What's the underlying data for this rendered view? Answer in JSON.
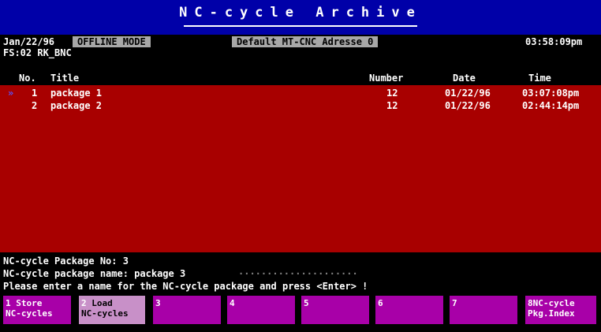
{
  "header": {
    "app_title": "NC-cycle Archive",
    "date": "Jan/22/96",
    "mode": "OFFLINE MODE",
    "address": "Default MT-CNC Adresse 0",
    "time": "03:58:09pm",
    "status_line": "FS:02 RK_BNC"
  },
  "table": {
    "columns": [
      "No.",
      "Title",
      "Number",
      "Date",
      "Time"
    ],
    "cursor_glyph": "»",
    "rows": [
      {
        "no": "1",
        "title": "package 1",
        "number": "12",
        "date": "01/22/96",
        "time": "03:07:08pm"
      },
      {
        "no": "2",
        "title": "package 2",
        "number": "12",
        "date": "01/22/96",
        "time": "02:44:14pm"
      }
    ]
  },
  "prompts": {
    "package_no": "NC-cycle Package No: 3",
    "package_name_label": "NC-cycle package name: package 3",
    "dots": "·····················",
    "instruction": "Please enter a name for the NC-cycle package and press <Enter> !"
  },
  "fkeys": [
    {
      "num": "1",
      "line1": "Store",
      "line2": "NC-cycles"
    },
    {
      "num": "2",
      "line1": "Load",
      "line2": "NC-cycles"
    },
    {
      "num": "3",
      "line1": "",
      "line2": ""
    },
    {
      "num": "4",
      "line1": "",
      "line2": ""
    },
    {
      "num": "5",
      "line1": "",
      "line2": ""
    },
    {
      "num": "6",
      "line1": "",
      "line2": ""
    },
    {
      "num": "7",
      "line1": "",
      "line2": ""
    },
    {
      "num": "8",
      "line1": "NC-cycle",
      "line2": "Pkg.Index"
    }
  ],
  "colors": {
    "title_bg": "#0000a8",
    "list_bg": "#a80000",
    "fkey_bg": "#a800a8"
  }
}
